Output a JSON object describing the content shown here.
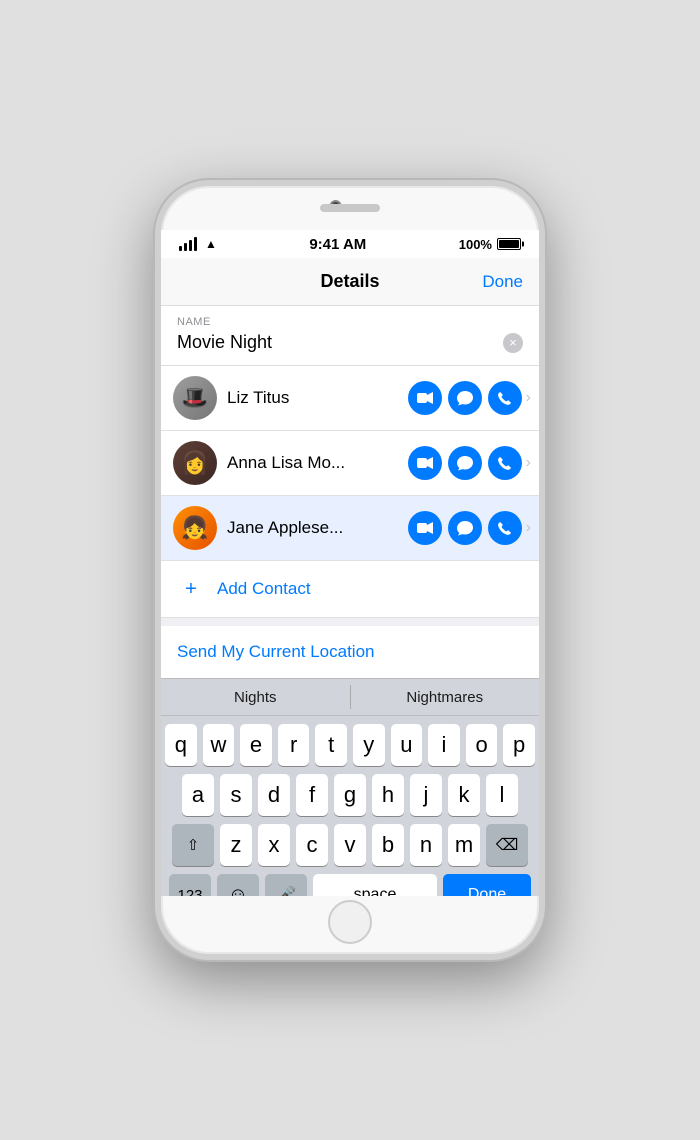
{
  "phone": {
    "status_bar": {
      "time": "9:41 AM",
      "battery": "100%"
    },
    "nav": {
      "title": "Details",
      "done": "Done"
    },
    "name_section": {
      "label": "NAME",
      "value": "Movie Night",
      "clear_label": "×"
    },
    "contacts": [
      {
        "id": "liz",
        "name": "Liz Titus",
        "avatar_emoji": "🧢"
      },
      {
        "id": "anna",
        "name": "Anna Lisa Mo...",
        "avatar_emoji": "👩"
      },
      {
        "id": "jane",
        "name": "Jane Applese...",
        "avatar_emoji": "👩‍🦳"
      }
    ],
    "add_contact": {
      "label": "Add Contact"
    },
    "send_location": {
      "label": "Send My Current Location"
    },
    "autocomplete": {
      "items": [
        "Nights",
        "Nightmares"
      ]
    },
    "keyboard": {
      "rows": [
        [
          "q",
          "w",
          "e",
          "r",
          "t",
          "y",
          "u",
          "i",
          "o",
          "p"
        ],
        [
          "a",
          "s",
          "d",
          "f",
          "g",
          "h",
          "j",
          "k",
          "l"
        ],
        [
          "z",
          "x",
          "c",
          "v",
          "b",
          "n",
          "m"
        ]
      ],
      "bottom": {
        "numbers": "123",
        "emoji": "☺",
        "space": "space",
        "done": "Done"
      }
    }
  }
}
